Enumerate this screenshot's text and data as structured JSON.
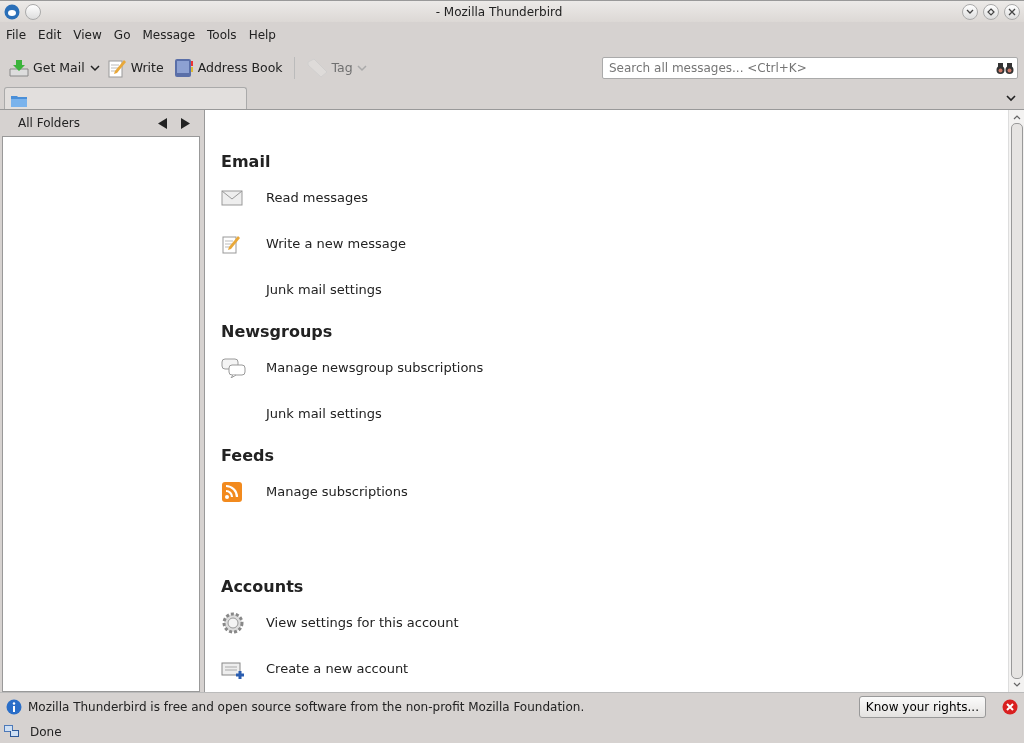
{
  "window": {
    "title": "- Mozilla Thunderbird"
  },
  "menu": [
    "File",
    "Edit",
    "View",
    "Go",
    "Message",
    "Tools",
    "Help"
  ],
  "toolbar": [
    {
      "label": "Get Mail",
      "kind": "inbox",
      "dropdown": true,
      "disabled": false
    },
    {
      "label": "Write",
      "kind": "write",
      "dropdown": false,
      "disabled": false
    },
    {
      "label": "Address Book",
      "kind": "book",
      "dropdown": false,
      "disabled": false
    },
    {
      "label": "Tag",
      "kind": "tag",
      "dropdown": true,
      "disabled": true
    }
  ],
  "search": {
    "placeholder": "Search all messages... <Ctrl+K>"
  },
  "folder_pane": {
    "title": "All Folders"
  },
  "sections": [
    {
      "kind": "normal",
      "heading": "Email",
      "items": [
        {
          "label": "Read messages",
          "kind": "envelope"
        },
        {
          "label": "Write a new message",
          "kind": "write"
        },
        {
          "label": "Junk mail settings",
          "kind": "plain"
        }
      ]
    },
    {
      "kind": "normal",
      "heading": "Newsgroups",
      "items": [
        {
          "label": "Manage newsgroup subscriptions",
          "kind": "speech"
        },
        {
          "label": "Junk mail settings",
          "kind": "plain"
        }
      ]
    },
    {
      "kind": "normal",
      "heading": "Feeds",
      "items": [
        {
          "label": "Manage subscriptions",
          "kind": "rss"
        }
      ]
    },
    {
      "kind": "spaced",
      "heading": "Accounts",
      "items": [
        {
          "label": "View settings for this account",
          "kind": "gear"
        },
        {
          "label": "Create a new account",
          "kind": "newaccount"
        }
      ]
    }
  ],
  "notification": {
    "text": "Mozilla Thunderbird is free and open source software from the non-profit Mozilla Foundation.",
    "button": "Know your rights..."
  },
  "status_bar": {
    "text": "Done"
  }
}
